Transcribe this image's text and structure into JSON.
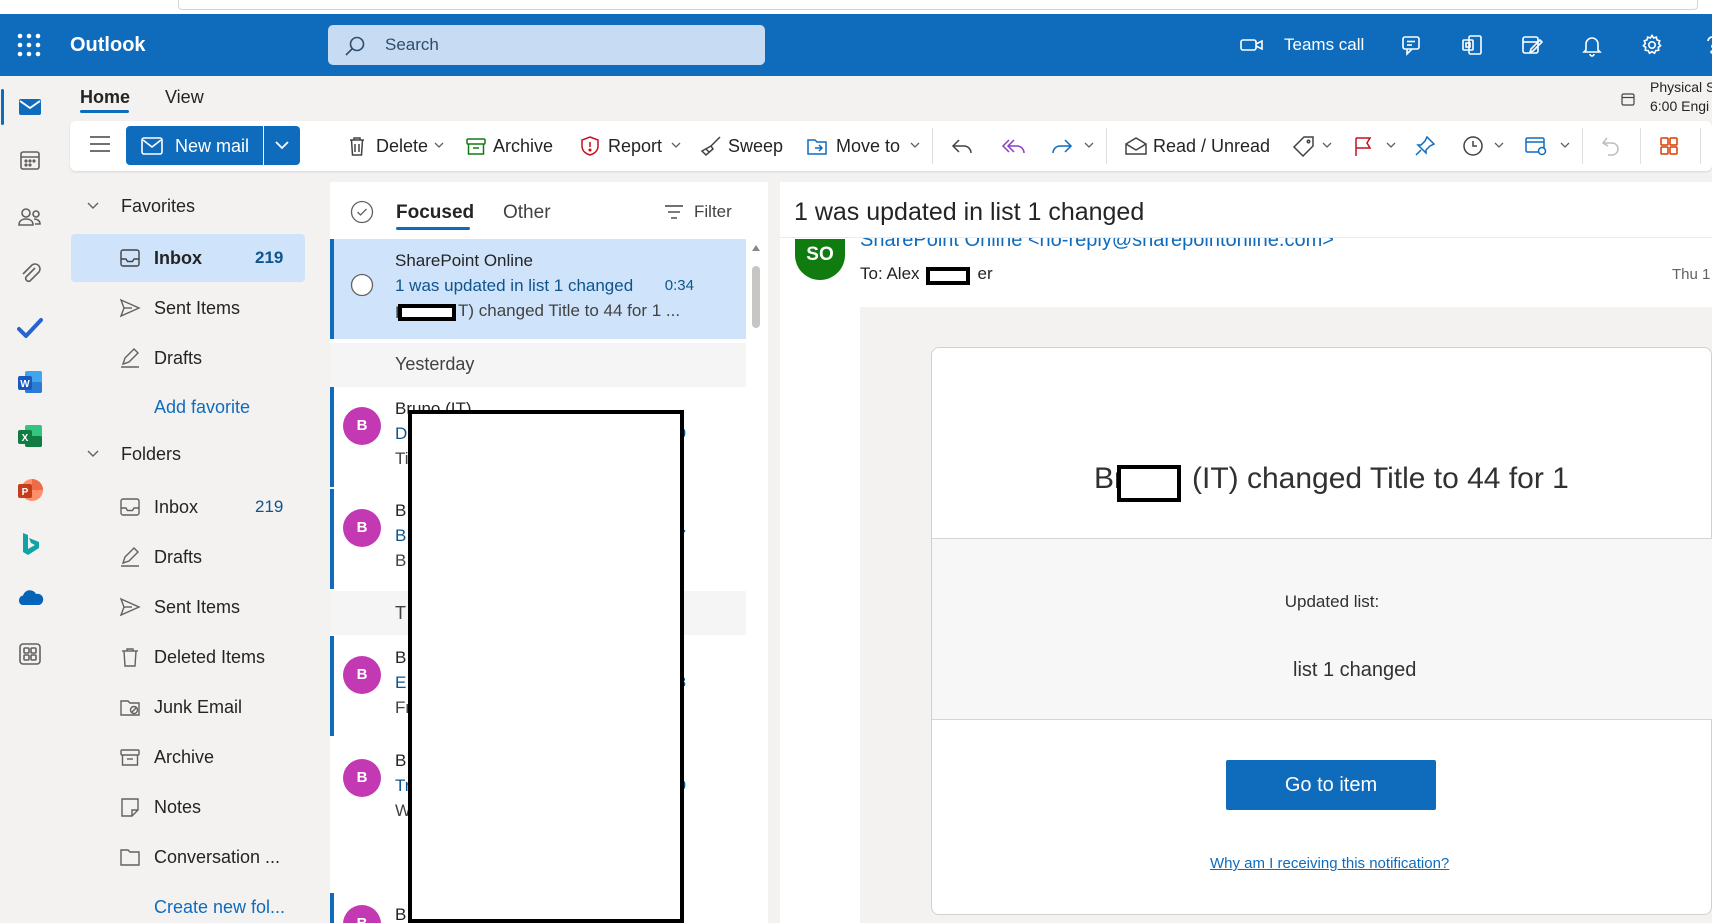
{
  "app": {
    "title": "Outlook",
    "accent": "#0f6cbd"
  },
  "search": {
    "placeholder": "Search"
  },
  "topbar": {
    "teams_call": "Teams call",
    "icons": [
      "teams-call-icon",
      "teams-chat-icon",
      "office-icon",
      "my-day-icon",
      "bell-icon",
      "gear-icon",
      "help-icon"
    ]
  },
  "rail": {
    "icons": [
      "mail-icon",
      "calendar-icon",
      "people-icon",
      "attachment-icon",
      "todo-icon",
      "word-icon",
      "excel-icon",
      "powerpoint-icon",
      "bing-icon",
      "onedrive-icon",
      "more-apps-icon"
    ]
  },
  "ribbon": {
    "tabs": [
      "Home",
      "View"
    ],
    "new_mail": "New mail",
    "delete": "Delete",
    "archive": "Archive",
    "report": "Report",
    "sweep": "Sweep",
    "move_to": "Move to",
    "read_unread": "Read / Unread"
  },
  "calendar_peek": {
    "line1": "Physical S",
    "line2": "6:00 Engi"
  },
  "favorites": {
    "header": "Favorites",
    "items": [
      {
        "label": "Inbox",
        "count": "219"
      },
      {
        "label": "Sent Items",
        "count": ""
      },
      {
        "label": "Drafts",
        "count": ""
      }
    ],
    "add": "Add favorite"
  },
  "folders": {
    "header": "Folders",
    "items": [
      {
        "label": "Inbox",
        "count": "219"
      },
      {
        "label": "Drafts",
        "count": ""
      },
      {
        "label": "Sent Items",
        "count": ""
      },
      {
        "label": "Deleted Items",
        "count": ""
      },
      {
        "label": "Junk Email",
        "count": ""
      },
      {
        "label": "Archive",
        "count": ""
      },
      {
        "label": "Notes",
        "count": ""
      },
      {
        "label": "Conversation ...",
        "count": ""
      }
    ],
    "create": "Create new fol..."
  },
  "list": {
    "tabs": [
      "Focused",
      "Other"
    ],
    "filter": "Filter",
    "selected": {
      "sender": "SharePoint Online",
      "subject": "1 was updated in list 1 changed",
      "time": "0:34",
      "preview": "T) changed Title to 44 for 1 ..."
    },
    "groups": [
      "Yesterday",
      "T"
    ],
    "items": [
      {
        "avatar": "B",
        "sender": "Bruno (IT)",
        "subject": "D",
        "preview": "Ti",
        "time": "0"
      },
      {
        "avatar": "B",
        "sender": "B",
        "subject": "B",
        "preview": "B",
        "time": "7"
      },
      {
        "avatar": "B",
        "sender": "B",
        "subject": "E",
        "preview": "Fr",
        "time": "8"
      },
      {
        "avatar": "B",
        "sender": "B",
        "subject": "Tr",
        "preview": "W",
        "time": "0"
      },
      {
        "avatar": "B",
        "sender": "B",
        "subject": "",
        "preview": "",
        "time": ""
      }
    ]
  },
  "reading": {
    "title": "1 was updated in list 1 changed",
    "avatar": "SO",
    "from": "SharePoint Online <no-reply@sharepointonline.com>",
    "to_prefix": "To: Alex",
    "to_suffix": "er",
    "date": "Thu 1",
    "change_prefix": "Br",
    "change_suffix": "(IT) changed Title to 44 for 1",
    "updated_label": "Updated list:",
    "list_name": "list 1 changed",
    "button": "Go to item",
    "why_link": "Why am I receiving this notification?"
  }
}
